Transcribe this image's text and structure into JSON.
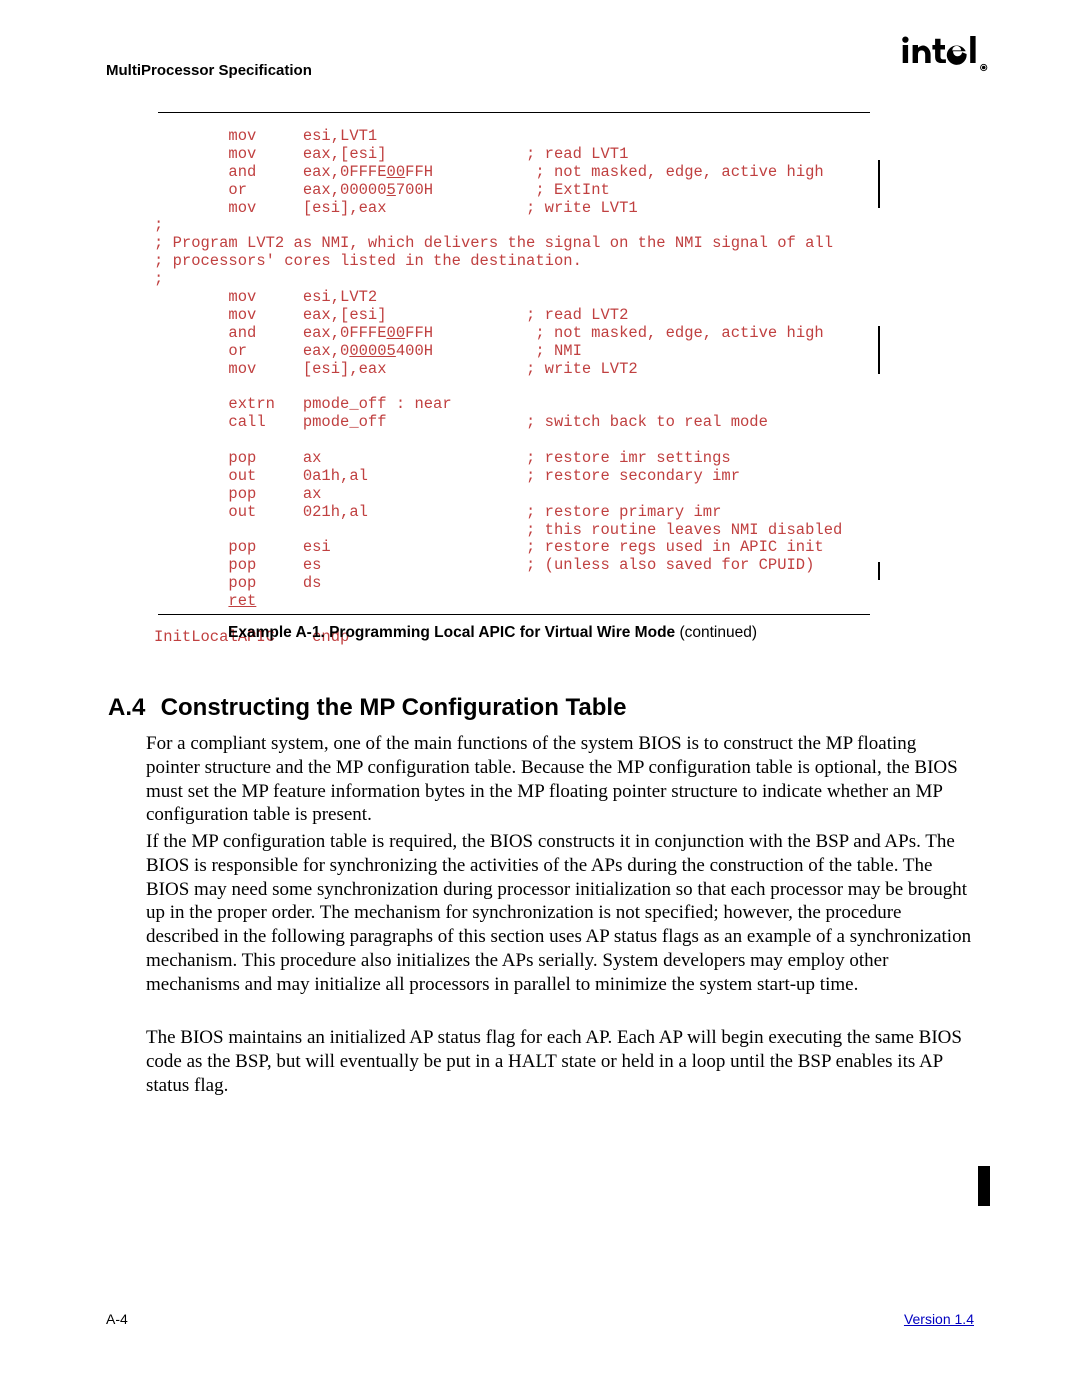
{
  "header": {
    "title": "MultiProcessor Specification"
  },
  "code": {
    "l01a": "        mov     esi,LVT1",
    "l01b": "        mov     eax,[esi]               ; read LVT1",
    "l01c": "        and     eax,0FFFE",
    "l01c_u": "00",
    "l01c2": "FFH           ; not masked, edge, active high",
    "l01d": "        or      eax,00000",
    "l01d_u": "5",
    "l01d2": "700H           ; ExtInt",
    "l01e": "        mov     [esi],eax               ; write LVT1",
    "l02a": ";",
    "l02b": "; Program LVT2 as NMI, which delivers the signal on the NMI signal of all",
    "l02c": "; processors' cores listed in the destination.",
    "l02d": ";",
    "l03a": "        mov     esi,LVT2",
    "l03b": "        mov     eax,[esi]               ; read LVT2",
    "l03c": "        and     eax,0FFFE",
    "l03c_u": "00",
    "l03c2": "FFH           ; not masked, edge, active high",
    "l03d": "        or      eax,0",
    "l03d_u": "00005",
    "l03d2": "400H           ; NMI",
    "l03e": "        mov     [esi],eax               ; write LVT2",
    "l04a": "        extrn   pmode_off : near",
    "l04b": "        call    pmode_off               ; switch back to real mode",
    "l05a": "        pop     ax                      ; restore imr settings",
    "l05b": "        out     0a1h,al                 ; restore secondary imr",
    "l05c": "        pop     ax",
    "l05d": "        out     021h,al                 ; restore primary imr",
    "l05e": "                                        ; this routine leaves NMI disabled",
    "l05f": "        pop     esi                     ; restore regs used in APIC init",
    "l05g": "        pop     es                      ; (unless also saved for CPUID)",
    "l05h": "        pop     ds",
    "l05i_pre": "        ",
    "l05i_u": "ret",
    "l06a": "InitLocalAPIC    endp"
  },
  "caption": {
    "bold": "Example A-1.  Programming Local APIC for Virtual Wire Mode ",
    "rest": "(continued)"
  },
  "section": {
    "num": "A.4",
    "title": "Constructing the MP Configuration Table"
  },
  "paragraphs": {
    "p1": "For a compliant system, one of the main functions of the system BIOS is to construct the MP floating pointer structure and the MP configuration table.  Because the MP configuration table is optional, the BIOS must set the MP feature information bytes in the MP floating pointer structure to indicate whether an MP configuration table is present.",
    "p2": "If the MP configuration table is required, the BIOS constructs it in conjunction with the BSP and APs.  The BIOS is responsible for synchronizing the activities of the APs during the construction of the table.  The BIOS may need some synchronization during processor initialization so that each processor may be brought up in the proper order.  The mechanism for synchronization is not specified; however, the procedure described in the following paragraphs of this section uses AP status flags as an example of a synchronization mechanism.  This procedure also initializes the APs serially.  System developers may employ other mechanisms and may initialize all processors in parallel to minimize the system start-up time.",
    "p3": "The BIOS maintains an initialized AP status flag for each AP.  Each AP will begin executing the same BIOS code as the BSP, but will eventually be put in a HALT state or held in a loop until the BSP enables its AP status flag."
  },
  "footer": {
    "pageNumber": "A-4",
    "version": "Version 1.4"
  }
}
